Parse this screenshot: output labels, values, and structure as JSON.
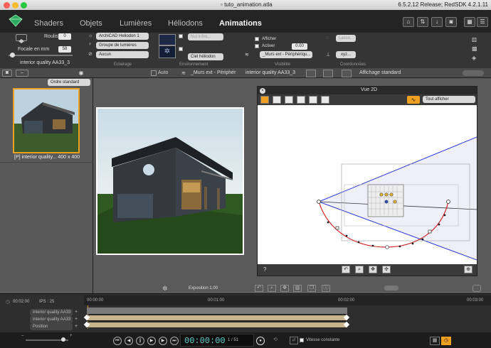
{
  "window": {
    "title": "tuto_animation.atla",
    "release": "6.5.2.12 Release; RedSDK 4.2.1.11"
  },
  "nav": {
    "tabs": [
      "Shaders",
      "Objets",
      "Lumières",
      "Héliodons",
      "Animations"
    ],
    "active": "Animations"
  },
  "props": {
    "roulis_label": "Roulis",
    "roulis_value": "0",
    "focale_label": "Focale en mm",
    "focale_value": "58",
    "camera_name": "interior quality AA33_3",
    "heliodon_select": "ArchiCAD Heliodon 1",
    "lights_group_select": "Groupe de lumières",
    "aucun_select": "Aucun",
    "nul_infini": "Nul infini...",
    "ciel_select": "Ciel héliodon",
    "afficher_label": "Afficher",
    "activer_label": "Activer",
    "activer_value": "0.00",
    "layer_select": "_Murs ext - Périphériqu...",
    "lasso_label": "Lasso...",
    "xyz_label": "xyz...",
    "groups": [
      "Eclairage",
      "Environnement",
      "Visibilité",
      "Coordonnées"
    ]
  },
  "toolbar2": {
    "auto_label": "Auto",
    "layer_label": "_Murs ext - Périphér",
    "camera_label": "interior quality AA33_3",
    "display_label": "Affichage standard"
  },
  "left_panel": {
    "sort_select": "Ordre standard",
    "thumb_caption": "[P] interior quality... 400 x 400"
  },
  "render": {
    "exposure_label": "Exposition 1.00"
  },
  "vue2d": {
    "title": "Vue 2D",
    "display_select": "Tout afficher",
    "help": "?"
  },
  "timeline": {
    "time_label": "00:02:00",
    "ips_label": "IPS : 25",
    "ticks": [
      "00:00:00",
      "00:01:00",
      "00:02:00",
      "00:03:00"
    ],
    "track_labels": [
      "interior quality AA33",
      "interior quality AA33",
      "Position"
    ]
  },
  "transport": {
    "timecode": "00:00:00",
    "frame_counter": "1 / 51",
    "constant_speed_label": "Vitesse constante"
  },
  "colors": {
    "accent_orange": "#f0a020",
    "track_tan": "#c8b48c",
    "path_red": "#cc0000",
    "cone_blue": "#2f3fd8"
  }
}
